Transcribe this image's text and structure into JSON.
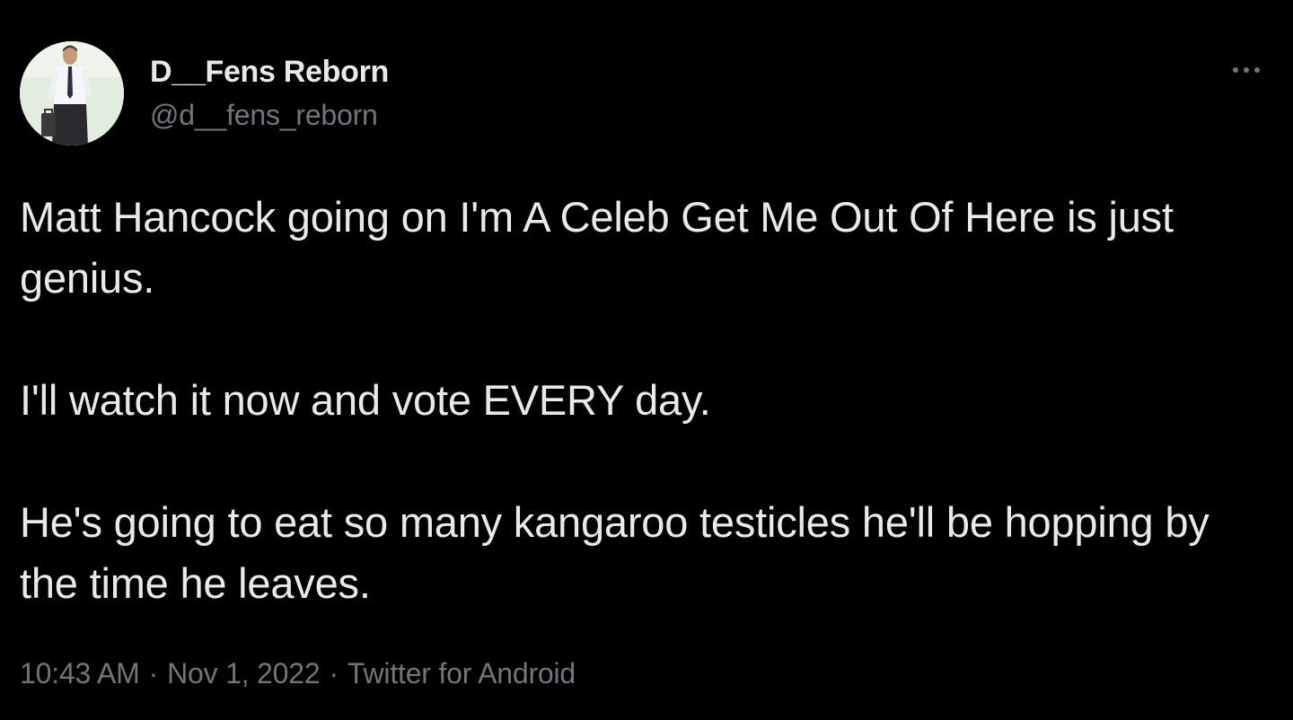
{
  "author": {
    "display_name": "D__Fens Reborn",
    "handle": "@d__fens_reborn"
  },
  "tweet": {
    "paragraphs": [
      "Matt Hancock going on I'm A Celeb Get Me Out Of Here is just genius.",
      "I'll watch it now and vote EVERY day.",
      "He's going to eat so many kangaroo testicles he'll be hopping by the time he leaves."
    ]
  },
  "meta": {
    "time": "10:43 AM",
    "separator": "·",
    "date": "Nov 1, 2022",
    "source": "Twitter for Android"
  },
  "icons": {
    "more": "more-horizontal-icon"
  },
  "colors": {
    "background": "#000000",
    "primary_text": "#e7e9ea",
    "secondary_text": "#71767b"
  }
}
